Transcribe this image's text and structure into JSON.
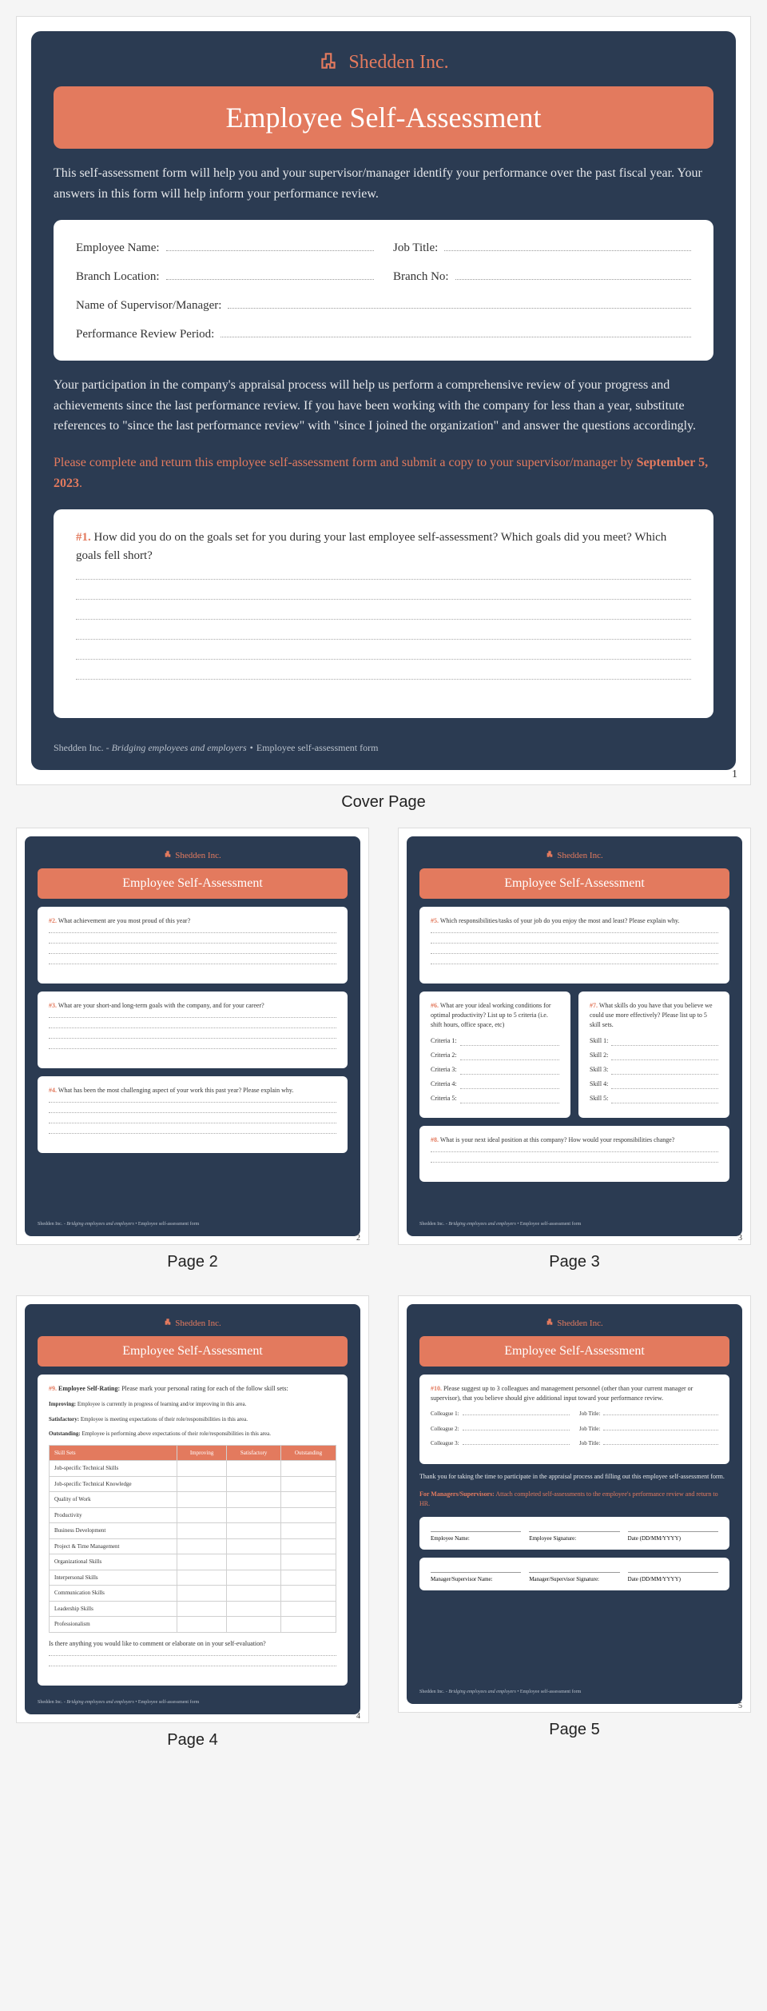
{
  "company": "Shedden Inc.",
  "title": "Employee Self-Assessment",
  "intro": "This self-assessment form will help you and your supervisor/manager identify your performance over the past fiscal year. Your answers in this form will help inform your performance review.",
  "fields": {
    "employee_name": "Employee Name:",
    "job_title": "Job Title:",
    "branch_location": "Branch Location:",
    "branch_no": "Branch No:",
    "supervisor": "Name of Supervisor/Manager:",
    "review_period": "Performance Review Period:"
  },
  "body1": "Your participation in the company's appraisal process will help us perform a comprehensive review of your progress and achievements since the last performance review. If you have been working with the company for less than a year, substitute references to \"since the last performance review\" with \"since I joined the organization\" and answer the questions accordingly.",
  "return_instruction_pre": "Please complete and return this employee self-assessment form and submit a copy to your supervisor/manager by ",
  "return_date": "September 5, 2023",
  "return_instruction_post": ".",
  "q1_num": "#1.",
  "q1": "How did you do on the goals set for you during your last employee self-assessment? Which goals did you meet? Which goals fell short?",
  "footer_company": "Shedden Inc.",
  "footer_tag": "Bridging employees and employers",
  "footer_doc": "Employee self-assessment form",
  "page1_num": "1",
  "cover_caption": "Cover Page",
  "p2": {
    "q2_num": "#2.",
    "q2": "What achievement are you most proud of this year?",
    "q3_num": "#3.",
    "q3": "What are your short-and long-term goals with the company, and for your career?",
    "q4_num": "#4.",
    "q4": "What has been the most challenging aspect of your work this past year? Please explain why.",
    "num": "2",
    "caption": "Page 2"
  },
  "p3": {
    "q5_num": "#5.",
    "q5": "Which responsibilities/tasks of your job do you enjoy the most and least? Please explain why.",
    "q6_num": "#6.",
    "q6": "What are your ideal working conditions for optimal productivity? List up to 5 criteria (i.e. shift hours, office space, etc)",
    "criteria": [
      "Criteria 1:",
      "Criteria 2:",
      "Criteria 3:",
      "Criteria 4:",
      "Criteria 5:"
    ],
    "q7_num": "#7.",
    "q7": "What skills do you have that you believe we could use more effectively? Please list up to 5 skill sets.",
    "skills": [
      "Skill 1:",
      "Skill 2:",
      "Skill 3:",
      "Skill 4:",
      "Skill 5:"
    ],
    "q8_num": "#8.",
    "q8": "What is your next ideal position at this company? How would your responsibilities change?",
    "num": "3",
    "caption": "Page 3"
  },
  "p4": {
    "q9_num": "#9.",
    "q9_intro": "Employee Self-Rating:",
    "q9": "Please mark your personal rating for each of the follow skill sets:",
    "rating_improving_label": "Improving:",
    "rating_improving": "Employee is currently in progress of learning and/or improving in this area.",
    "rating_satisfactory_label": "Satisfactory:",
    "rating_satisfactory": "Employee is meeting expectations of their role/responsibilities in this area.",
    "rating_outstanding_label": "Outstanding:",
    "rating_outstanding": "Employee is performing above expectations of their role/responsibilities in this area.",
    "th_skill": "Skill Sets",
    "th_imp": "Improving",
    "th_sat": "Satisfactory",
    "th_out": "Outstanding",
    "rows": [
      "Job-specific Technical Skills",
      "Job-specific Technical Knowledge",
      "Quality of Work",
      "Productivity",
      "Business Development",
      "Project & Time Management",
      "Organizational Skills",
      "Interpersonal Skills",
      "Communication Skills",
      "Leadership Skills",
      "Professionalism"
    ],
    "extra_q": "Is there anything you would like to comment or elaborate on in your self-evaluation?",
    "num": "4",
    "caption": "Page 4"
  },
  "p5": {
    "q10_num": "#10.",
    "q10": "Please suggest up to 3 colleagues and management personnel (other than your current manager or supervisor), that you believe should give additional input toward your performance review.",
    "colleague": "Colleague",
    "job_title": "Job Title:",
    "thanks": "Thank you for taking the time to participate in the appraisal process and filling out this employee self-assessment form.",
    "mgr_pre": "For Managers/Supervisors:",
    "mgr": "Attach completed self-assessments to the employee's performance review and return to HR.",
    "sig_emp_name": "Employee Name:",
    "sig_emp_sig": "Employee Signature:",
    "sig_date": "Date (DD/MM/YYYY)",
    "sig_mgr_name": "Manager/Supervisor Name:",
    "sig_mgr_sig": "Manager/Supervisor Signature:",
    "num": "5",
    "caption": "Page 5"
  }
}
